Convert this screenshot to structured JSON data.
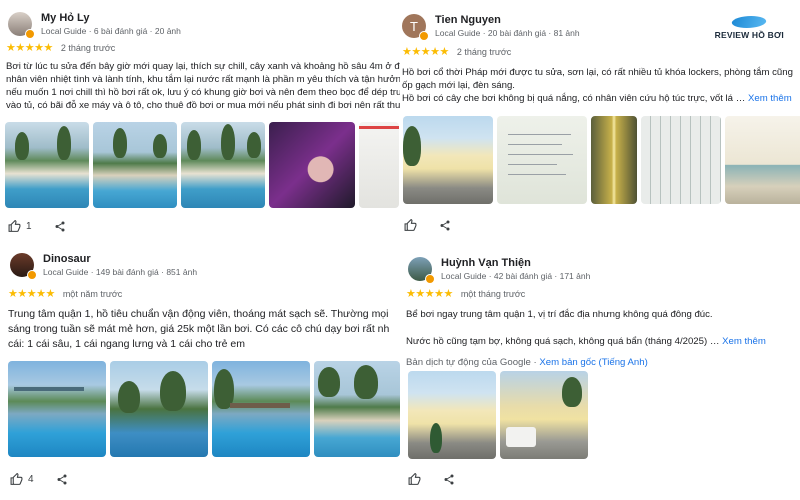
{
  "reviews": [
    {
      "name": "My Hỏ Ly",
      "meta": "Local Guide · 6 bài đánh giá · 20 ảnh",
      "stars": "★★★★★",
      "when": "2 tháng trước",
      "text_lines": [
        "Bơi từ lúc tu sửa đến bây giờ mới quay lại, thích sự chill, cây xanh và khoảng hồ sâu 4m ở đây",
        "nhân viên nhiệt tình và lành tính, khu tắm lại nước rất mạnh là phần m yêu thích và tận hưởng",
        "nếu muốn 1 nơi chill thì hồ bơi rất ok, lưu ý có khung giờ bơi và nên đem theo bọc để dép trước",
        "vào tủ, có bãi đỗ xe máy và ô tô, cho thuê đồ bơi or mua mới nếu phát sinh đi bơi nên rất thuận"
      ],
      "likes": "1"
    },
    {
      "name": "Tien Nguyen",
      "avatar_letter": "T",
      "meta": "Local Guide · 20 bài đánh giá · 81 ảnh",
      "stars": "★★★★★",
      "when": "2 tháng trước",
      "text_lines": [
        "Hồ bơi cổ thời Pháp mới được tu sửa, sơn lại, có rất nhiều tủ khóa lockers, phòng tắm cũng",
        "ốp gạch mới lại, đèn sáng.",
        "Hồ bơi có cây che bơi không bị quá nắng, có nhân viên cứu hộ túc trực, vốt lá"
      ],
      "more": "Xem thêm",
      "likes": ""
    },
    {
      "name": "Dinosaur",
      "meta": "Local Guide · 149 bài đánh giá · 851 ảnh",
      "stars": "★★★★★",
      "when": "một năm trước",
      "text_lines": [
        "Trung tâm quận 1, hồ tiêu chuẩn vận động viên, thoáng mát sạch sẽ. Thường mọi",
        "sáng trong tuần sẽ mát mẻ hơn, giá 25k một lần bơi. Có các cô chú dạy bơi rất nh",
        "cái: 1 cái sâu, 1 cái ngang lưng và 1 cái cho trẻ em"
      ],
      "likes": "4"
    },
    {
      "name": "Huỳnh Vạn Thiện",
      "meta": "Local Guide · 42 bài đánh giá · 171 ảnh",
      "stars": "★★★★★",
      "when": "một tháng trước",
      "text_lines": [
        "Bể bơi ngay trung tâm quận 1, vị trí đắc địa nhưng không quá đông đúc.",
        "Nước hồ cũng tạm bợ, không quá sạch, không quá bẩn (tháng 4/2025)"
      ],
      "more": "Xem thêm",
      "translate_note": "Bản dịch tự động của Google · ",
      "translate_link": "Xem bản gốc (Tiếng Anh)",
      "likes": ""
    }
  ],
  "brand": {
    "text": "REVIEW HỒ BƠI"
  },
  "colors": {
    "star": "#fbbc04",
    "link": "#1a73e8",
    "local_guide_badge": "#f29900",
    "avatar_tien": "#a0765b"
  },
  "icons": {
    "like": "thumb-up-icon",
    "share": "share-icon",
    "badge": "local-guide-badge-icon"
  }
}
